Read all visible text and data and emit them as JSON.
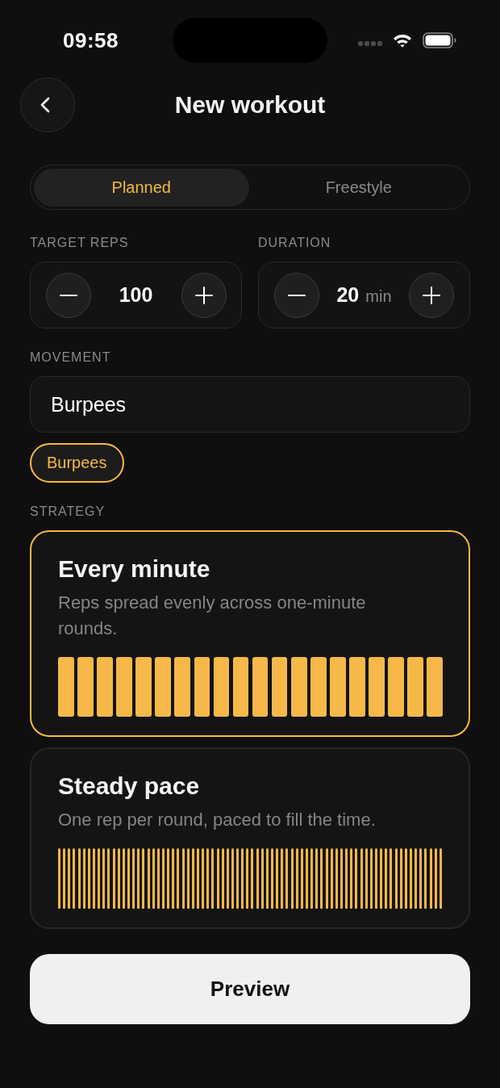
{
  "status_bar": {
    "time": "09:58"
  },
  "header": {
    "title": "New workout"
  },
  "mode_tabs": [
    {
      "label": "Planned",
      "selected": true
    },
    {
      "label": "Freestyle",
      "selected": false
    }
  ],
  "steppers": [
    {
      "label": "TARGET REPS",
      "value": "100"
    },
    {
      "label": "DURATION",
      "value": "20",
      "unit": "min"
    }
  ],
  "movement": {
    "label": "MOVEMENT",
    "value": "Burpees",
    "suggestions": [
      {
        "label": "Burpees",
        "selected": true
      }
    ]
  },
  "strategy": {
    "label": "STRATEGY",
    "options": [
      {
        "kind": "rounds",
        "title": "Every minute",
        "description": "Reps spread evenly across one-minute rounds.",
        "selected": true
      },
      {
        "kind": "steady",
        "title": "Steady pace",
        "description": "One rep per round, paced to fill the time.",
        "selected": false
      }
    ]
  },
  "preview_button": {
    "label": "Preview"
  }
}
